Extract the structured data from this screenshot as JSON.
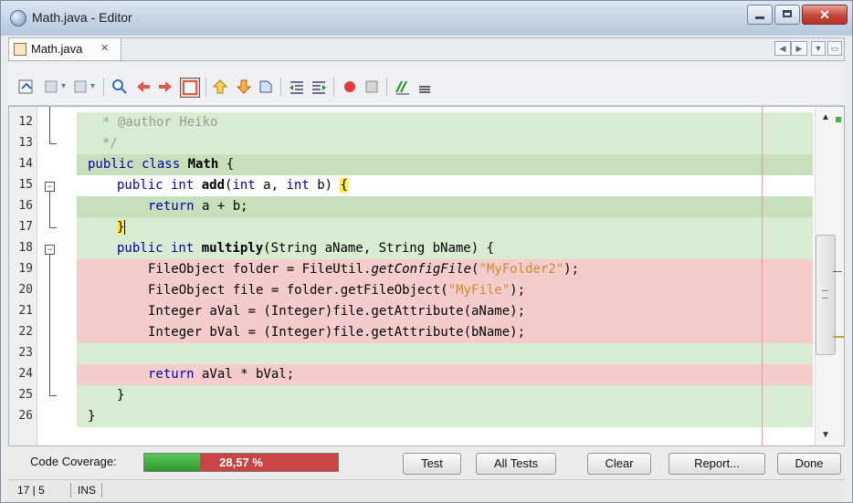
{
  "window": {
    "title": "Math.java - Editor"
  },
  "tab": {
    "label": "Math.java",
    "close": "✕"
  },
  "editor": {
    "lines": [
      {
        "no": "12",
        "status": "green"
      },
      {
        "no": "13",
        "status": "green"
      },
      {
        "no": "14",
        "status": "greenmid"
      },
      {
        "no": "15",
        "status": "white"
      },
      {
        "no": "16",
        "status": "greenmid"
      },
      {
        "no": "17",
        "status": "green"
      },
      {
        "no": "18",
        "status": "green"
      },
      {
        "no": "19",
        "status": "red"
      },
      {
        "no": "20",
        "status": "red"
      },
      {
        "no": "21",
        "status": "red"
      },
      {
        "no": "22",
        "status": "red"
      },
      {
        "no": "23",
        "status": "green"
      },
      {
        "no": "24",
        "status": "red"
      },
      {
        "no": "25",
        "status": "green"
      },
      {
        "no": "26",
        "status": "green"
      }
    ],
    "code": {
      "l12_star": "* ",
      "l12_text": "@author Heiko",
      "l13": "*/",
      "l14_kw": "public class ",
      "l14_name": "Math",
      "l14_end": " {",
      "l15_kw1": "public int ",
      "l15_name": "add",
      "l15_mid1": "(",
      "l15_kw2": "int",
      "l15_mid2": " a, ",
      "l15_kw3": "int",
      "l15_mid3": " b) ",
      "l15_brace": "{",
      "l16_kw": "return",
      "l16_rest": " a + b;",
      "l17_brace": "}",
      "l18_kw": "public int ",
      "l18_name": "multiply",
      "l18_rest": "(String aName, String bName) {",
      "l19_a": "FileObject folder = FileUtil.",
      "l19_m": "getConfigFile",
      "l19_b": "(",
      "l19_s": "\"MyFolder2\"",
      "l19_c": ");",
      "l20_a": "FileObject file = folder.getFileObject(",
      "l20_s": "\"MyFile\"",
      "l20_c": ");",
      "l21": "Integer aVal = (Integer)file.getAttribute(aName);",
      "l22": "Integer bVal = (Integer)file.getAttribute(bName);",
      "l24_kw": "return",
      "l24_rest": " aVal * bVal;",
      "l25": "}",
      "l26": "}"
    }
  },
  "coverage": {
    "label": "Code Coverage:",
    "percent_text": "28,57 %",
    "percent_value": 28.57
  },
  "buttons": {
    "test": "Test",
    "all_tests": "All Tests",
    "clear": "Clear",
    "report": "Report...",
    "done": "Done"
  },
  "status": {
    "position": "17 | 5",
    "mode": "INS"
  },
  "colors": {
    "covered": "#d7ecd0",
    "uncovered": "#f4cccc",
    "coverage_green": "#3fae3f",
    "coverage_red": "#c94545"
  }
}
